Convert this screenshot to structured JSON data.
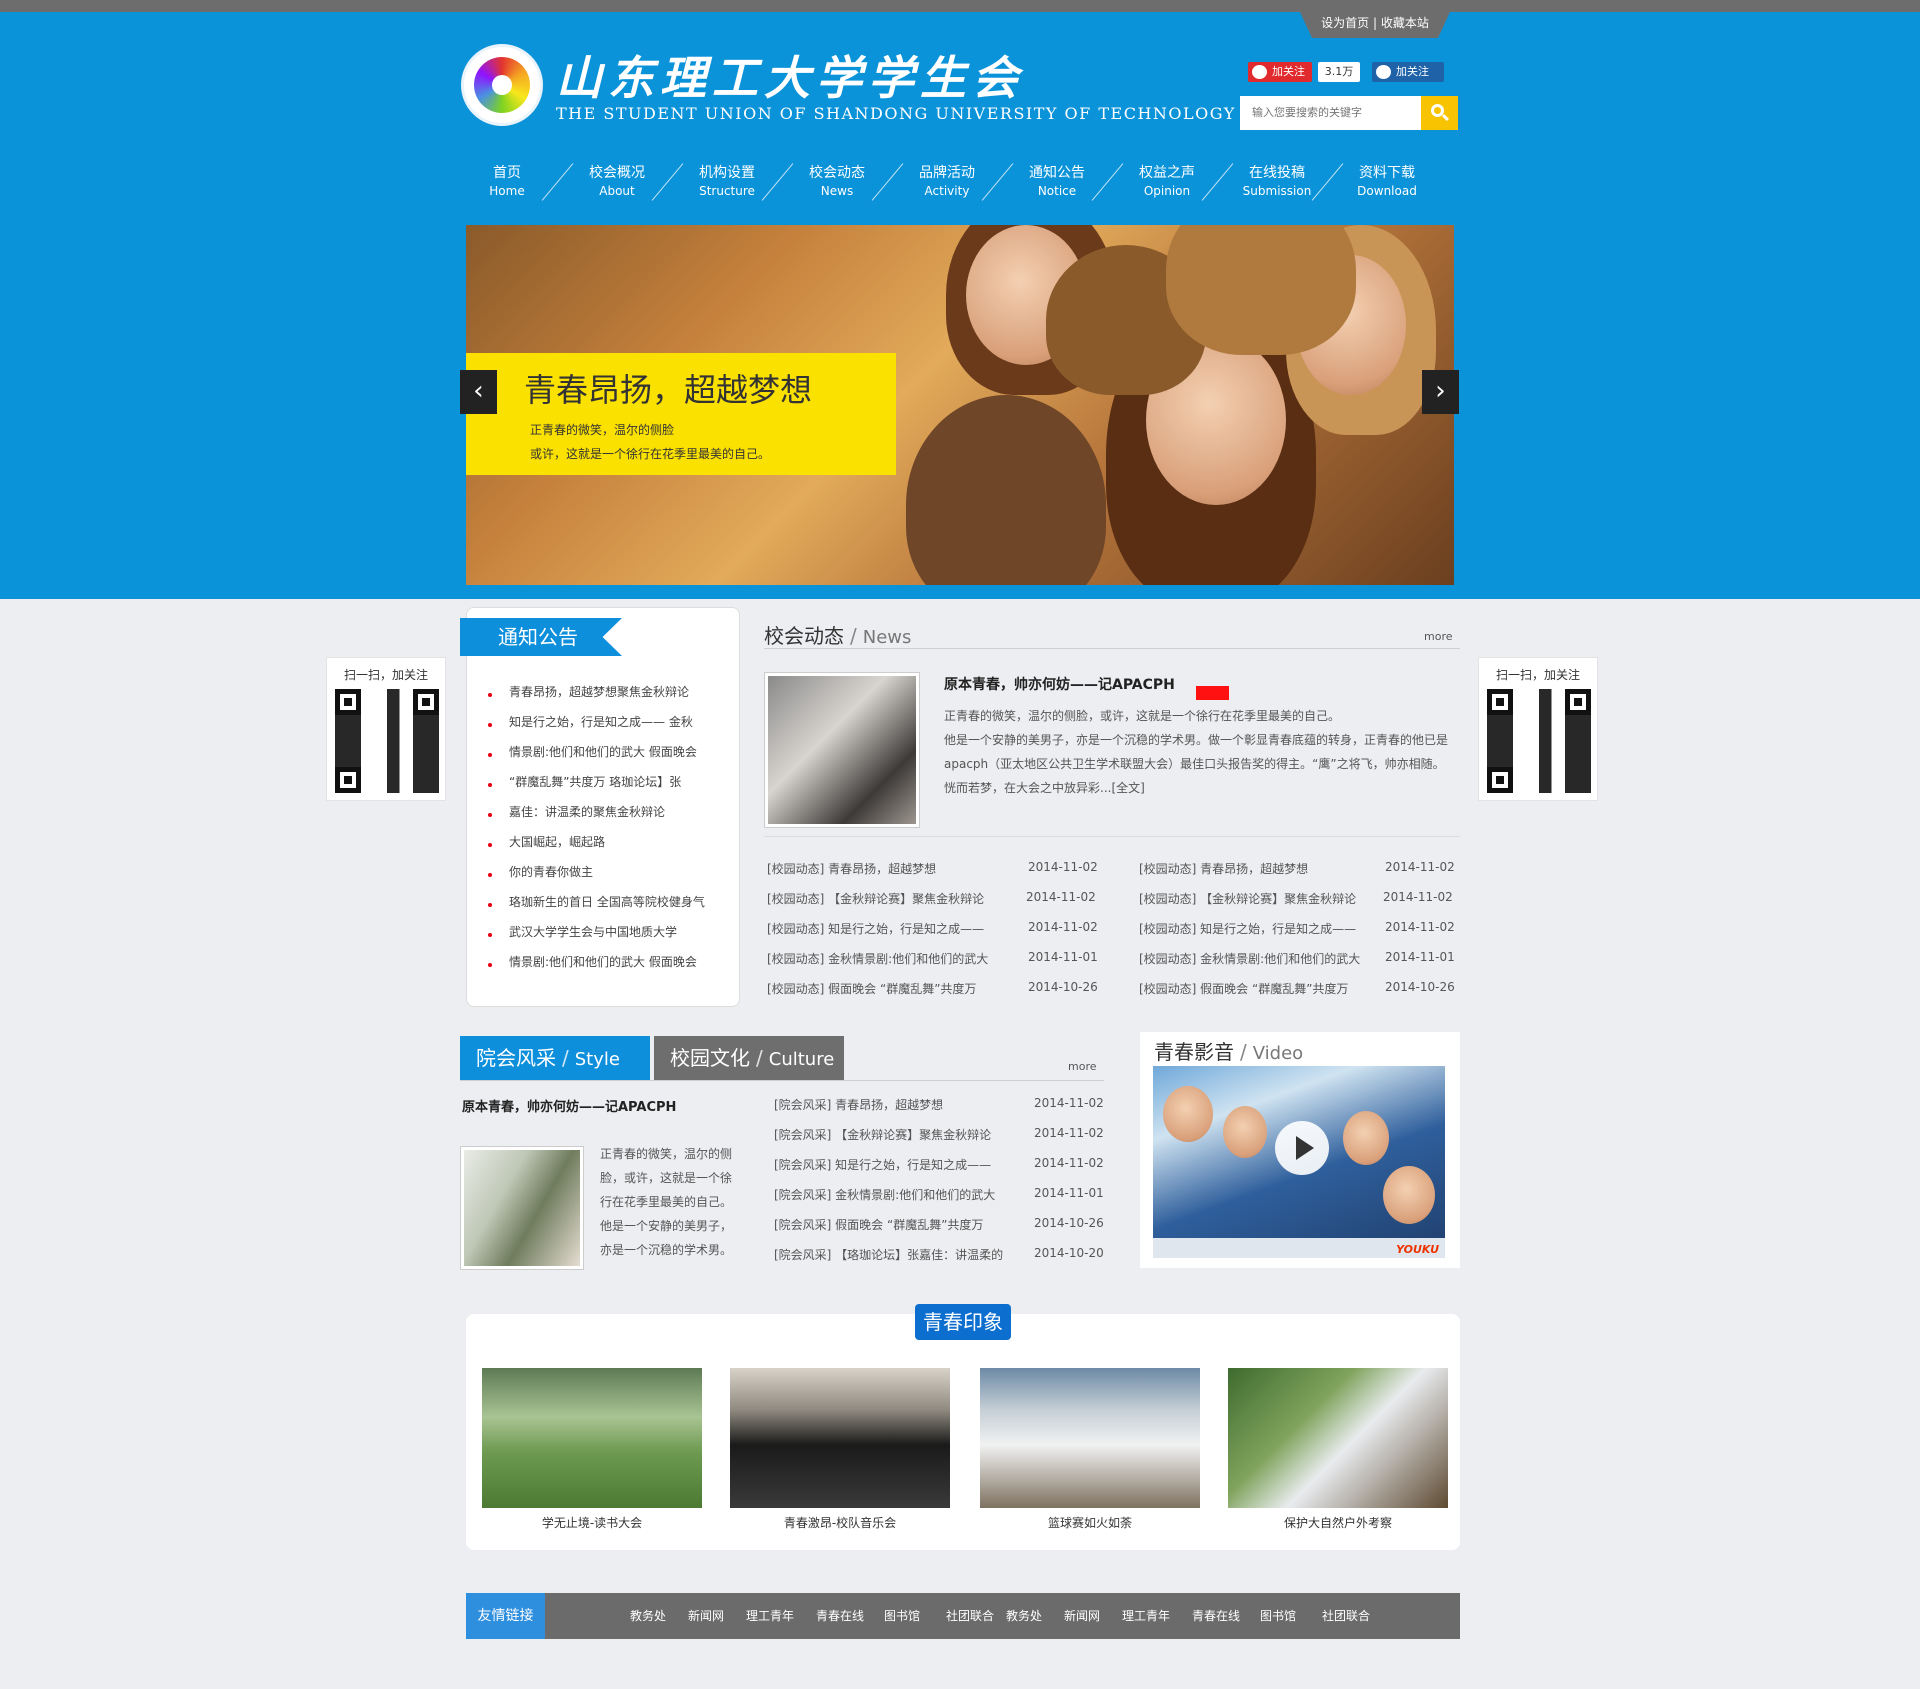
{
  "colors": {
    "primary": "#0b93d9",
    "topbar": "#6d6d6d",
    "caption": "#fbe100",
    "notice": "#e60012",
    "accent_yellow": "#f8c300"
  },
  "top_links": {
    "set_home": "设为首页",
    "separator": "|",
    "bookmark": "收藏本站"
  },
  "brand": {
    "title": "山东理工大学学生会",
    "subtitle": "THE STUDENT UNION OF SHANDONG UNIVERSITY OF TECHNOLOGY",
    "logo_icon": "logo-emblem-icon"
  },
  "social": {
    "weibo_label": "加关注",
    "weibo_count": "3.1万",
    "renren_label": "加关注"
  },
  "search": {
    "placeholder": "输入您要搜索的关键字",
    "button_icon": "search-icon"
  },
  "nav": [
    {
      "cn": "首页",
      "en": "Home"
    },
    {
      "cn": "校会概况",
      "en": "About"
    },
    {
      "cn": "机构设置",
      "en": "Structure"
    },
    {
      "cn": "校会动态",
      "en": "News"
    },
    {
      "cn": "品牌活动",
      "en": "Activity"
    },
    {
      "cn": "通知公告",
      "en": "Notice"
    },
    {
      "cn": "权益之声",
      "en": "Opinion"
    },
    {
      "cn": "在线投稿",
      "en": "Submission"
    },
    {
      "cn": "资料下载",
      "en": "Download"
    }
  ],
  "banner": {
    "title": "青春昂扬，超越梦想",
    "line1": "正青春的微笑，温尔的侧脸",
    "line2": "或许，这就是一个徐行在花季里最美的自己。",
    "prev_icon": "chevron-left-icon",
    "next_icon": "chevron-right-icon"
  },
  "qr": {
    "left_label": "扫一扫，加关注",
    "right_label": "扫一扫，加关注"
  },
  "notice": {
    "title": "通知公告",
    "items": [
      "青春昂扬，超越梦想聚焦金秋辩论",
      "知是行之始，行是知之成—— 金秋",
      "情景剧:他们和他们的武大 假面晚会",
      "“群魔乱舞”共度万 珞珈论坛】张",
      "嘉佳：讲温柔的聚焦金秋辩论",
      "大国崛起，崛起路",
      "你的青春你做主",
      "珞珈新生的首日 全国高等院校健身气",
      "武汉大学学生会与中国地质大学",
      "情景剧:他们和他们的武大 假面晚会"
    ]
  },
  "news": {
    "title_cn": "校会动态",
    "slash": "/",
    "title_en": "News",
    "more": "more",
    "feature_title": "原本青春，帅亦何妨——记APACPH",
    "feature_lines": [
      "正青春的微笑，温尔的侧脸，或许，这就是一个徐行在花季里最美的自己。",
      "他是一个安静的美男子，亦是一个沉稳的学术男。做一个彰显青春底蕴的转身，正青春的他已是",
      "apacph（亚太地区公共卫生学术联盟大会）最佳口头报告奖的得主。“鹰”之将飞，帅亦相随。",
      "恍而若梦，在大会之中放异彩...[全文]"
    ],
    "left": [
      {
        "text": "[校园动态] 青春昂扬，超越梦想",
        "date": "2014-11-02"
      },
      {
        "text": "[校园动态] 【金秋辩论赛】聚焦金秋辩论",
        "date": "2014-11-02"
      },
      {
        "text": "[校园动态] 知是行之始，行是知之成——",
        "date": "2014-11-02"
      },
      {
        "text": "[校园动态] 金秋情景剧:他们和他们的武大",
        "date": "2014-11-01"
      },
      {
        "text": "[校园动态] 假面晚会 “群魔乱舞”共度万",
        "date": "2014-10-26"
      }
    ],
    "right": [
      {
        "text": "[校园动态] 青春昂扬，超越梦想",
        "date": "2014-11-02"
      },
      {
        "text": "[校园动态] 【金秋辩论赛】聚焦金秋辩论",
        "date": "2014-11-02"
      },
      {
        "text": "[校园动态] 知是行之始，行是知之成——",
        "date": "2014-11-02"
      },
      {
        "text": "[校园动态] 金秋情景剧:他们和他们的武大",
        "date": "2014-11-01"
      },
      {
        "text": "[校园动态] 假面晚会 “群魔乱舞”共度万",
        "date": "2014-10-26"
      }
    ]
  },
  "style": {
    "tab1_cn": "院会风采",
    "tab1_en": "Style",
    "tab2_cn": "校园文化",
    "tab2_en": "Culture",
    "slash": "/",
    "more": "more",
    "feature_title": "原本青春，帅亦何妨——记APACPH",
    "feature_lines": [
      "正青春的微笑，温尔的侧",
      "脸，或许，这就是一个徐",
      "行在花季里最美的自己。",
      "他是一个安静的美男子，",
      "亦是一个沉稳的学术男。"
    ],
    "items": [
      {
        "text": "[院会风采] 青春昂扬，超越梦想",
        "date": "2014-11-02"
      },
      {
        "text": "[院会风采] 【金秋辩论赛】聚焦金秋辩论",
        "date": "2014-11-02"
      },
      {
        "text": "[院会风采] 知是行之始，行是知之成——",
        "date": "2014-11-02"
      },
      {
        "text": "[院会风采] 金秋情景剧:他们和他们的武大",
        "date": "2014-11-01"
      },
      {
        "text": "[院会风采] 假面晚会 “群魔乱舞”共度万",
        "date": "2014-10-26"
      },
      {
        "text": "[院会风采] 【珞珈论坛】张嘉佳：讲温柔的",
        "date": "2014-10-20"
      }
    ]
  },
  "video": {
    "title_cn": "青春影音",
    "slash": "/",
    "title_en": "Video",
    "player_logo": "YOUKU",
    "play_icon": "play-icon"
  },
  "impression": {
    "title": "青春印象",
    "photos": [
      {
        "caption": "学无止境-读书大会"
      },
      {
        "caption": "青春激昂-校队音乐会"
      },
      {
        "caption": "篮球赛如火如荼"
      },
      {
        "caption": "保护大自然户外考察"
      }
    ]
  },
  "links": {
    "title": "友情链接",
    "items": [
      "教务处",
      "新闻网",
      "理工青年",
      "青春在线",
      "图书馆",
      "社团联合",
      "教务处",
      "新闻网",
      "理工青年",
      "青春在线",
      "图书馆",
      "社团联合"
    ]
  }
}
